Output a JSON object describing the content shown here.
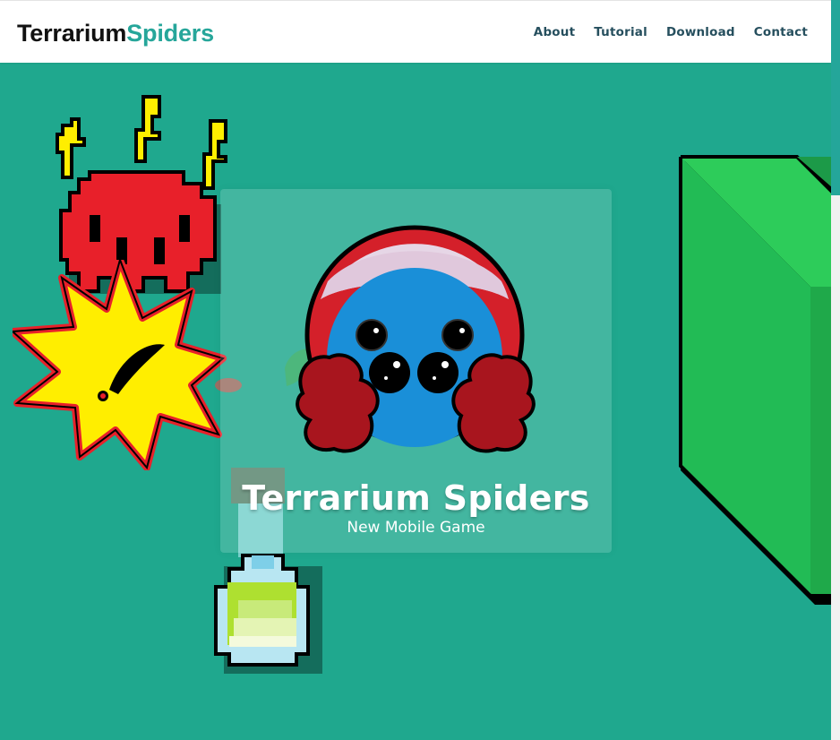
{
  "navbar": {
    "brand_part1": "Terrarium",
    "brand_part2": "Spiders",
    "links": [
      "About",
      "Tutorial",
      "Download",
      "Contact"
    ]
  },
  "hero": {
    "title": "Terrarium Spiders",
    "subtitle": "New Mobile Game"
  },
  "colors": {
    "background": "#1fa88e",
    "brand_accent": "#26a69a",
    "nav_link": "#264f5e"
  },
  "icons": [
    "red-lightning-monster-icon",
    "explosion-icon",
    "potion-bottle-icon",
    "green-block-icon",
    "spider-logo-icon"
  ]
}
